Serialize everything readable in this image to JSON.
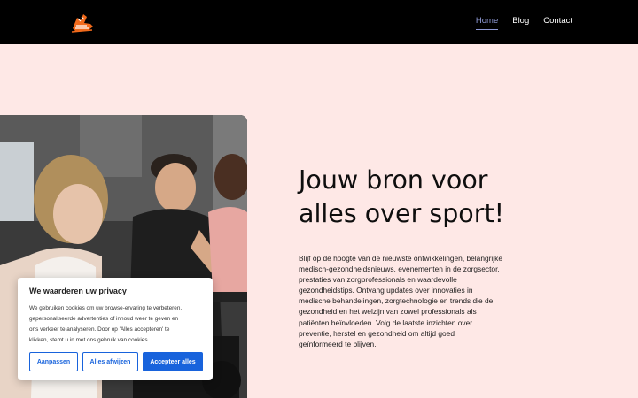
{
  "header": {
    "logo_icon": "sneaker-icon",
    "nav": [
      {
        "label": "Home",
        "active": true
      },
      {
        "label": "Blog",
        "active": false
      },
      {
        "label": "Contact",
        "active": false
      }
    ]
  },
  "hero": {
    "image_alt": "spinning-class-photo",
    "headline_lines": [
      "Jouw bron voor",
      "alles over sport!"
    ],
    "body_lines": [
      "Blijf op de hoogte van de nieuwste ontwikkelingen, belangrijke",
      "medisch-gezondheidsnieuws, evenementen in de zorgsector,",
      "prestaties van zorgprofessionals en waardevolle",
      "gezondheidstips. Ontvang updates over innovaties in",
      "medische behandelingen, zorgtechnologie en trends die de",
      "gezondheid en het welzijn van zowel professionals als",
      "patiënten beïnvloeden. Volg de laatste inzichten over",
      "preventie, herstel en gezondheid om altijd goed",
      "geïnformeerd te blijven."
    ]
  },
  "cookie_banner": {
    "title": "We waarderen uw privacy",
    "text_lines": [
      "We gebruiken cookies om uw browse-ervaring te verbeteren,",
      "gepersonaliseerde advertenties of inhoud weer te geven en",
      "ons verkeer te analyseren. Door op 'Alles accepteren' te",
      "klikken, stemt u in met ons gebruik van cookies."
    ],
    "customize_label": "Aanpassen",
    "reject_label": "Alles afwijzen",
    "accept_label": "Accepteer alles"
  },
  "colors": {
    "header_bg": "#000000",
    "page_bg": "#fee8e6",
    "accent": "#1863dc",
    "logo_orange": "#f26a1b",
    "nav_active": "#8f9ad6"
  }
}
